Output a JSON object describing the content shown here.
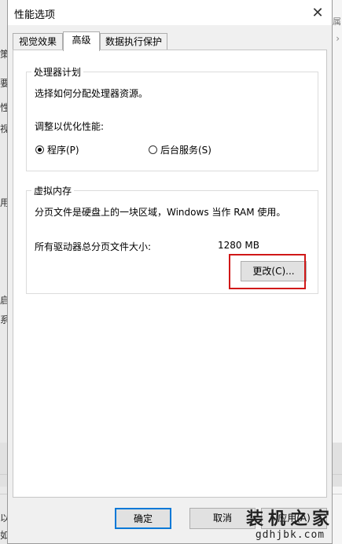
{
  "background": {
    "left_chars": [
      "策",
      "要",
      "性",
      "视",
      "用",
      "启",
      "系",
      "以",
      "如"
    ],
    "right_text": "属"
  },
  "dialog": {
    "title": "性能选项",
    "close_symbol": "✕"
  },
  "tabs": [
    {
      "label": "视觉效果",
      "active": false
    },
    {
      "label": "高级",
      "active": true
    },
    {
      "label": "数据执行保护",
      "active": false
    }
  ],
  "processor": {
    "group_label": "处理器计划",
    "description": "选择如何分配处理器资源。",
    "adjust_label": "调整以优化性能:",
    "options": [
      {
        "label": "程序(P)",
        "checked": true
      },
      {
        "label": "后台服务(S)",
        "checked": false
      }
    ]
  },
  "virtual_memory": {
    "group_label": "虚拟内存",
    "description": "分页文件是硬盘上的一块区域，Windows 当作 RAM 使用。",
    "total_label": "所有驱动器总分页文件大小:",
    "total_value": "1280 MB",
    "change_button": "更改(C)..."
  },
  "footer": {
    "ok_button": "确定",
    "cancel_button": "取消",
    "apply_button": "应用(A)"
  },
  "watermark": {
    "main": "装机之家",
    "sub": "gdhjbk.com"
  },
  "colors": {
    "highlight": "#d01818",
    "default_button_border": "#0078d7"
  }
}
